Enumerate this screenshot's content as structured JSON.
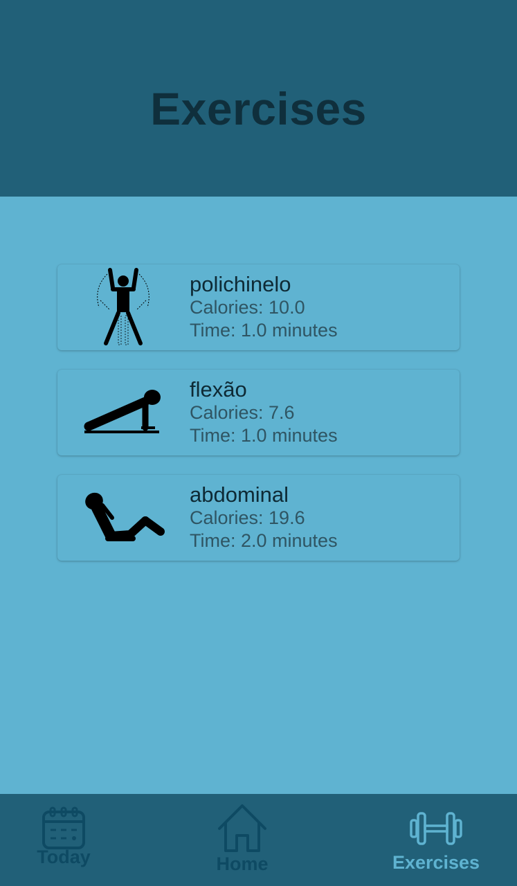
{
  "header": {
    "title": "Exercises"
  },
  "exercises": [
    {
      "name": "polichinelo",
      "calories": "Calories: 10.0",
      "time": "Time: 1.0 minutes",
      "icon": "jumping-jack-icon"
    },
    {
      "name": "flexão",
      "calories": "Calories: 7.6",
      "time": "Time: 1.0 minutes",
      "icon": "push-up-icon"
    },
    {
      "name": "abdominal",
      "calories": "Calories: 19.6",
      "time": "Time: 2.0 minutes",
      "icon": "sit-up-icon"
    }
  ],
  "nav": {
    "today": "Today",
    "home": "Home",
    "exercises": "Exercises",
    "active": "exercises"
  },
  "colors": {
    "header_bg": "#216078",
    "page_bg": "#5fb3d1",
    "title": "#0f2f3c",
    "nav_inactive": "#0e4a63",
    "nav_active": "#5fb3d1"
  }
}
